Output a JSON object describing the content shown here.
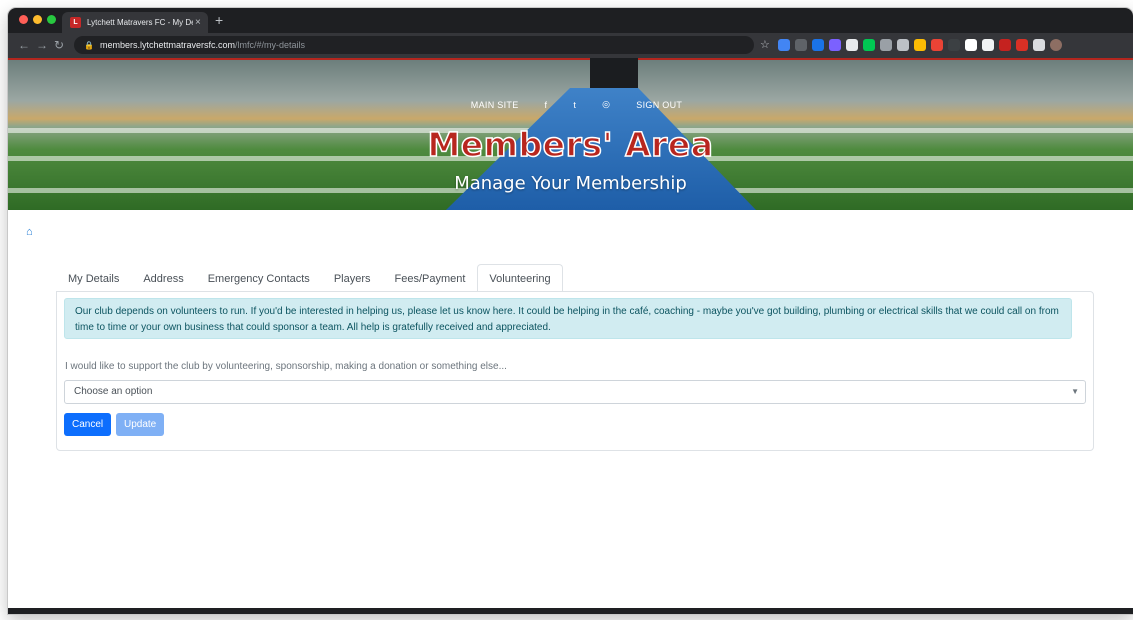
{
  "browser": {
    "tab_title": "Lytchett Matravers FC - My De",
    "tab_close": "×",
    "new_tab": "+",
    "url_host": "members.lytchettmatraversfc.com",
    "url_path": "/lmfc/#/my-details",
    "favicon_letter": "L"
  },
  "hero": {
    "nav": {
      "main_site": "MAIN SITE",
      "facebook": "f",
      "twitter": "t",
      "instagram": "◎",
      "sign_out": "SIGN OUT"
    },
    "title": "Members' Area",
    "subtitle": "Manage Your Membership"
  },
  "tabs": [
    {
      "label": "My Details"
    },
    {
      "label": "Address"
    },
    {
      "label": "Emergency Contacts"
    },
    {
      "label": "Players"
    },
    {
      "label": "Fees/Payment"
    },
    {
      "label": "Volunteering"
    }
  ],
  "volunteering": {
    "info_text": "Our club depends on volunteers to run. If you'd be interested in helping us, please let us know here. It could be helping in the café, coaching - maybe you've got building, plumbing or electrical skills that we could call on from time to time or your own business that could sponsor a team. All help is gratefully received and appreciated.",
    "question": "I would like to support the club by volunteering, sponsorship, making a donation or something else...",
    "select_value": "Choose an option",
    "cancel_label": "Cancel",
    "update_label": "Update"
  },
  "colors": {
    "accent": "#0d6efd",
    "brand_red": "#b8261e",
    "info_bg": "#d1ecf1"
  }
}
